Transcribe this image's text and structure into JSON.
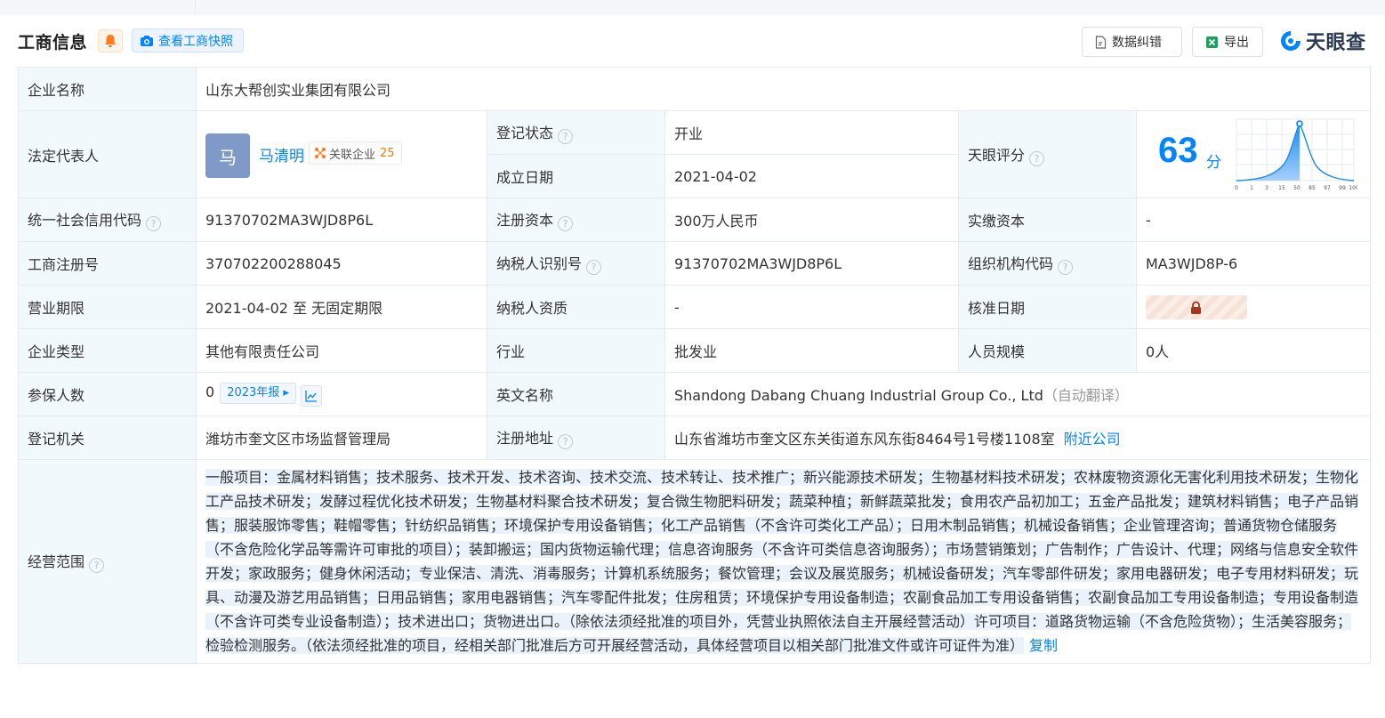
{
  "header": {
    "title": "工商信息",
    "snapshot_label": "查看工商快照",
    "correct_label": "数据纠错",
    "export_label": "导出",
    "logo_text": "天眼查"
  },
  "company": {
    "name_label": "企业名称",
    "name": "山东大帮创实业集团有限公司",
    "rep_label": "法定代表人",
    "rep_avatar": "马",
    "rep_name": "马清明",
    "rep_related_label": "关联企业",
    "rep_related_count": "25",
    "status_label": "登记状态",
    "status": "开业",
    "found_label": "成立日期",
    "found_date": "2021-04-02",
    "score_label": "天眼评分",
    "score": "63",
    "score_unit": "分",
    "credit_code_label": "统一社会信用代码",
    "credit_code": "91370702MA3WJD8P6L",
    "reg_capital_label": "注册资本",
    "reg_capital": "300万人民币",
    "paid_capital_label": "实缴资本",
    "paid_capital": "-",
    "reg_no_label": "工商注册号",
    "reg_no": "370702200288045",
    "taxpayer_id_label": "纳税人识别号",
    "taxpayer_id": "91370702MA3WJD8P6L",
    "org_code_label": "组织机构代码",
    "org_code": "MA3WJD8P-6",
    "term_label": "营业期限",
    "term": "2021-04-02 至 无固定期限",
    "tax_qual_label": "纳税人资质",
    "tax_qual": "-",
    "approve_label": "核准日期",
    "type_label": "企业类型",
    "type": "其他有限责任公司",
    "industry_label": "行业",
    "industry": "批发业",
    "staff_label": "人员规模",
    "staff": "0人",
    "insured_label": "参保人数",
    "insured": "0",
    "insured_year": "2023年报",
    "en_name_label": "英文名称",
    "en_name": "Shandong Dabang Chuang Industrial Group Co., Ltd",
    "en_name_note": "（自动翻译）",
    "authority_label": "登记机关",
    "authority": "潍坊市奎文区市场监督管理局",
    "address_label": "注册地址",
    "address": "山东省潍坊市奎文区东关街道东风东街8464号1号楼1108室",
    "nearby_label": "附近公司",
    "scope_label": "经营范围",
    "scope": "一般项目：金属材料销售；技术服务、技术开发、技术咨询、技术交流、技术转让、技术推广；新兴能源技术研发；生物基材料技术研发；农林废物资源化无害化利用技术研发；生物化工产品技术研发；发酵过程优化技术研发；生物基材料聚合技术研发；复合微生物肥料研发；蔬菜种植；新鲜蔬菜批发；食用农产品初加工；五金产品批发；建筑材料销售；电子产品销售；服装服饰零售；鞋帽零售；针纺织品销售；环境保护专用设备销售；化工产品销售（不含许可类化工产品）；日用木制品销售；机械设备销售；企业管理咨询；普通货物仓储服务（不含危险化学品等需许可审批的项目）；装卸搬运；国内货物运输代理；信息咨询服务（不含许可类信息咨询服务）；市场营销策划；广告制作；广告设计、代理；网络与信息安全软件开发；家政服务；健身休闲活动；专业保洁、清洗、消毒服务；计算机系统服务；餐饮管理；会议及展览服务；机械设备研发；汽车零部件研发；家用电器研发；电子专用材料研发；玩具、动漫及游艺用品销售；日用品销售；家用电器销售；汽车零配件批发；住房租赁；环境保护专用设备制造；农副食品加工专用设备销售；农副食品加工专用设备制造；专用设备制造（不含许可类专业设备制造）；技术进出口；货物进出口。（除依法须经批准的项目外，凭营业执照依法自主开展经营活动）许可项目：道路货物运输（不含危险货物）；生活美容服务；检验检测服务。（依法须经批准的项目，经相关部门批准后方可开展经营活动，具体经营项目以相关部门批准文件或许可证件为准）",
    "copy_label": "复制"
  },
  "score_chart": {
    "x_ticks": [
      "0",
      "1",
      "3",
      "15",
      "50",
      "85",
      "97",
      "99",
      "100"
    ]
  },
  "colors": {
    "accent": "#0084ff",
    "status_open": "#2db66a",
    "label_bg": "#f2f9fc",
    "border": "#e4e9f2"
  },
  "icons": {
    "bell": "bell-icon",
    "camera": "camera-icon",
    "correct": "doc-edit-icon",
    "excel": "excel-icon",
    "logo": "tianyancha-logo-icon",
    "help": "question-icon",
    "related": "network-icon",
    "lock": "lock-icon",
    "trend": "trend-chart-icon"
  }
}
